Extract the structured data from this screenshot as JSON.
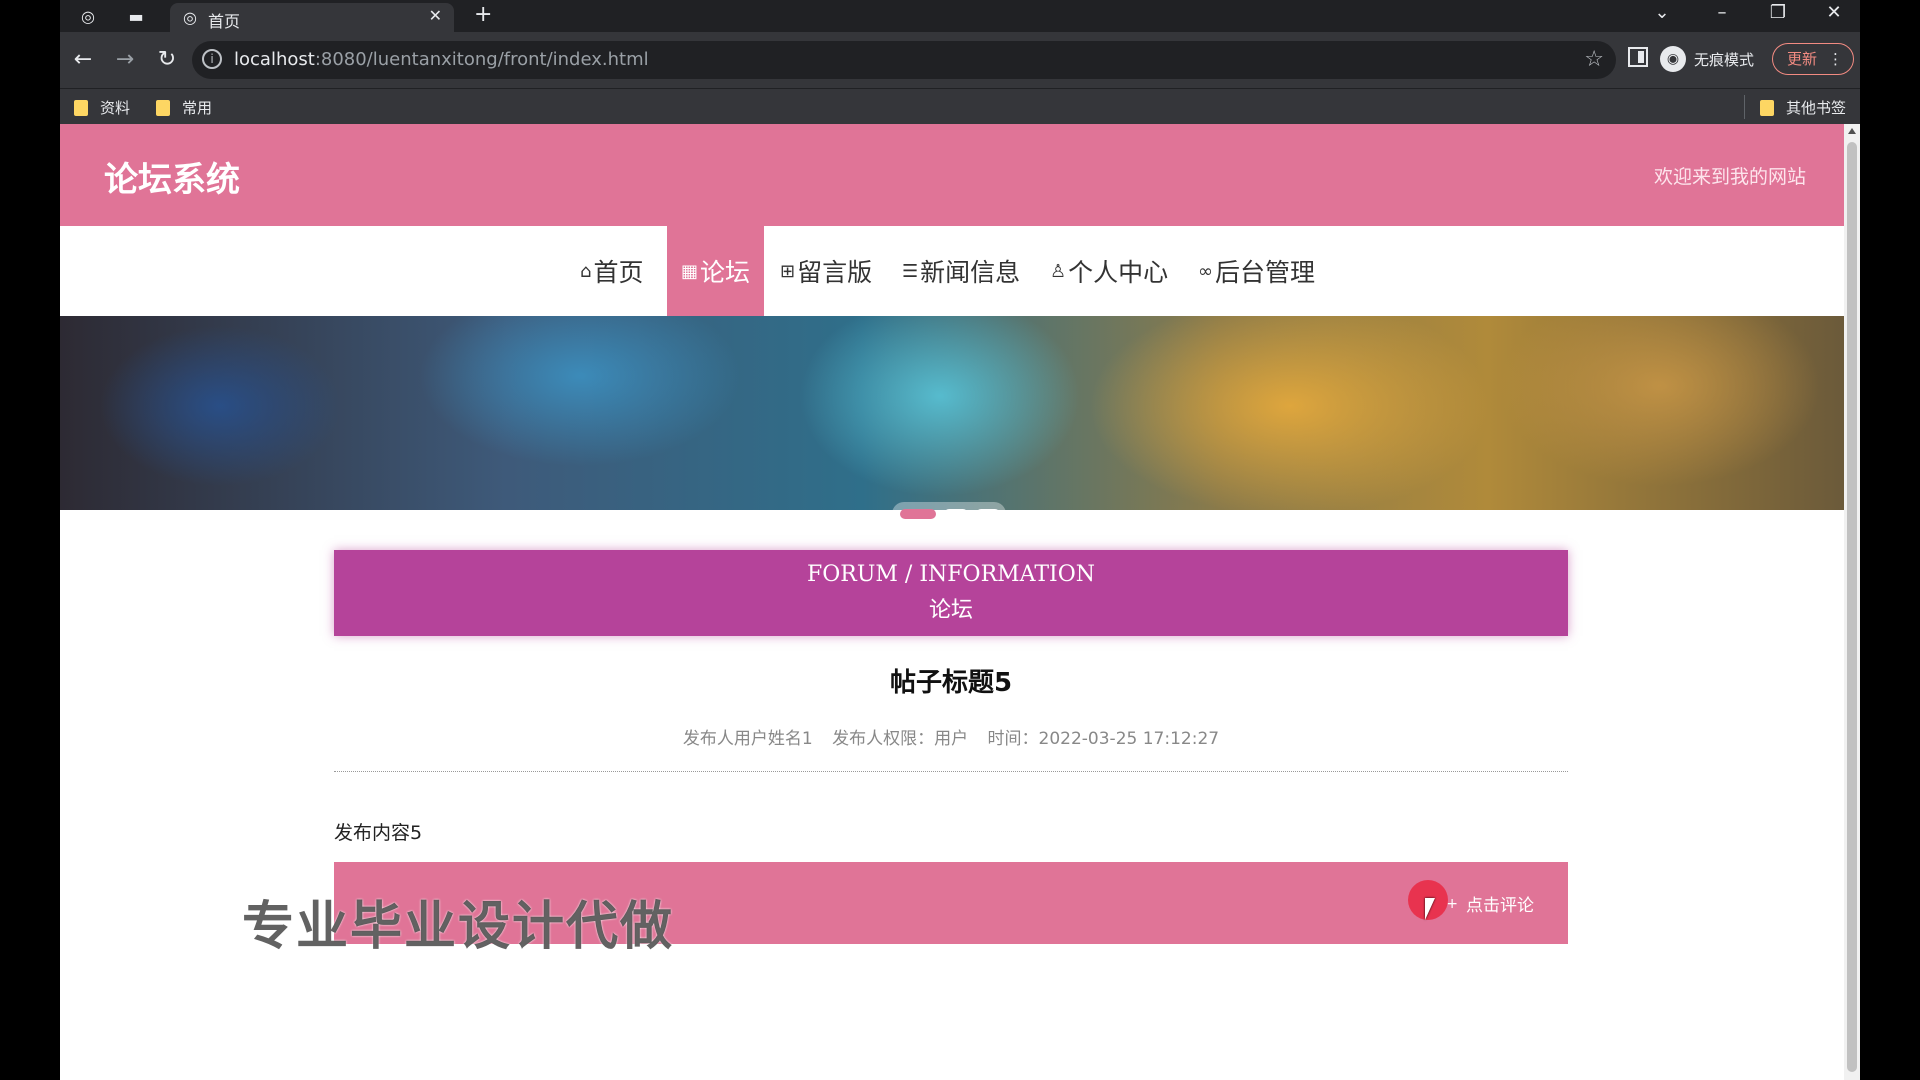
{
  "browser": {
    "tab_title": "首页",
    "url_host": "localhost",
    "url_rest": ":8080/luentanxitong/front/index.html",
    "incognito_label": "无痕模式",
    "update_label": "更新",
    "bookmarks": [
      {
        "label": "资料"
      },
      {
        "label": "常用"
      },
      {
        "label": "其他书签"
      }
    ]
  },
  "site": {
    "title": "论坛系统",
    "welcome": "欢迎来到我的网站"
  },
  "nav": {
    "items": [
      {
        "icon": "home-icon",
        "label": "首页",
        "active": false
      },
      {
        "icon": "forum-icon",
        "label": "论坛",
        "active": true
      },
      {
        "icon": "message-board-icon",
        "label": "留言版",
        "active": false
      },
      {
        "icon": "news-icon",
        "label": "新闻信息",
        "active": false
      },
      {
        "icon": "user-icon",
        "label": "个人中心",
        "active": false
      },
      {
        "icon": "link-icon",
        "label": "后台管理",
        "active": false
      }
    ]
  },
  "carousel": {
    "slide_count": 3,
    "active_index": 0
  },
  "section": {
    "title_en": "FORUM / INFORMATION",
    "title_cn": "论坛"
  },
  "post": {
    "title": "帖子标题5",
    "author": "发布人用户姓名1",
    "role": "发布人权限：用户",
    "time": "时间：2022-03-25 17:12:27",
    "content": "发布内容5"
  },
  "comment": {
    "button_label": "点击评论"
  },
  "overlay": {
    "watermark": "专业毕业设计代做"
  },
  "colors": {
    "header_pink": "#e07497",
    "band_magenta": "#b5439a"
  }
}
